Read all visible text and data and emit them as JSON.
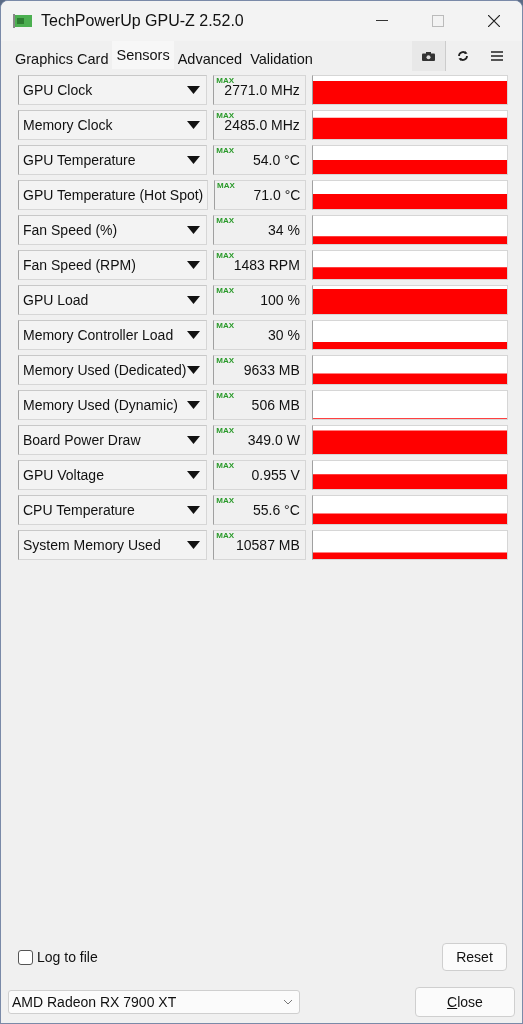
{
  "window": {
    "title": "TechPowerUp GPU-Z 2.52.0"
  },
  "tabs": [
    {
      "label": "Graphics Card",
      "selected": false
    },
    {
      "label": "Sensors",
      "selected": true
    },
    {
      "label": "Advanced",
      "selected": false
    },
    {
      "label": "Validation",
      "selected": false
    }
  ],
  "sensors": [
    {
      "name": "GPU Clock",
      "badge": "MAX",
      "value": "2771.0 MHz"
    },
    {
      "name": "Memory Clock",
      "badge": "MAX",
      "value": "2485.0 MHz"
    },
    {
      "name": "GPU Temperature",
      "badge": "MAX",
      "value": "54.0 °C"
    },
    {
      "name": "GPU Temperature (Hot Spot)",
      "badge": "MAX",
      "value": "71.0 °C"
    },
    {
      "name": "Fan Speed (%)",
      "badge": "MAX",
      "value": "34 %"
    },
    {
      "name": "Fan Speed (RPM)",
      "badge": "MAX",
      "value": "1483 RPM"
    },
    {
      "name": "GPU Load",
      "badge": "MAX",
      "value": "100 %"
    },
    {
      "name": "Memory Controller Load",
      "badge": "MAX",
      "value": "30 %"
    },
    {
      "name": "Memory Used (Dedicated)",
      "badge": "MAX",
      "value": "9633 MB"
    },
    {
      "name": "Memory Used (Dynamic)",
      "badge": "MAX",
      "value": "506 MB"
    },
    {
      "name": "Board Power Draw",
      "badge": "MAX",
      "value": "349.0 W"
    },
    {
      "name": "GPU Voltage",
      "badge": "MAX",
      "value": "0.955 V"
    },
    {
      "name": "CPU Temperature",
      "badge": "MAX",
      "value": "55.6 °C"
    },
    {
      "name": "System Memory Used",
      "badge": "MAX",
      "value": "10587 MB"
    }
  ],
  "log_to_file": {
    "label": "Log to file",
    "checked": false
  },
  "reset_button": "Reset",
  "device": {
    "value": "AMD Radeon RX 7900 XT"
  },
  "close_button": "Close"
}
